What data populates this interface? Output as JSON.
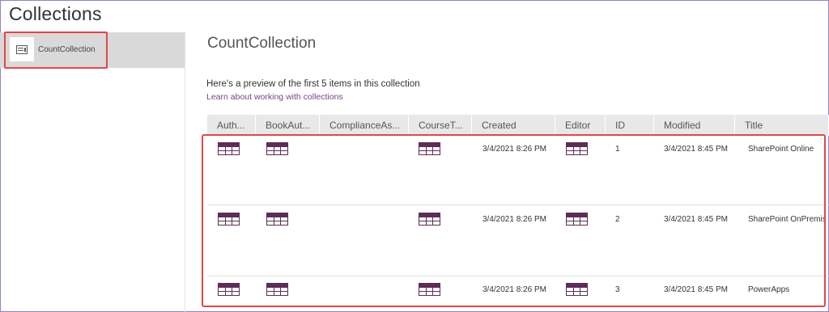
{
  "page": {
    "title": "Collections"
  },
  "sidebar": {
    "items": [
      {
        "label": "CountCollection",
        "icon": "table-icon"
      }
    ]
  },
  "main": {
    "collection_title": "CountCollection",
    "preview_text": "Here's a preview of the first 5 items in this collection",
    "learn_link": "Learn about working with collections",
    "columns": [
      "Auth...",
      "BookAut...",
      "ComplianceAs...",
      "CourseT...",
      "Created",
      "Editor",
      "ID",
      "Modified",
      "Title"
    ],
    "rows": [
      {
        "created": "3/4/2021 8:26 PM",
        "id": "1",
        "modified": "3/4/2021 8:45 PM",
        "title": "SharePoint Online"
      },
      {
        "created": "3/4/2021 8:26 PM",
        "id": "2",
        "modified": "3/4/2021 8:45 PM",
        "title": "SharePoint OnPremise"
      },
      {
        "created": "3/4/2021 8:26 PM",
        "id": "3",
        "modified": "3/4/2021 8:45 PM",
        "title": "PowerApps"
      }
    ]
  },
  "colors": {
    "accent": "#5c2d57",
    "link": "#7b3f87",
    "highlight": "#e04848"
  }
}
